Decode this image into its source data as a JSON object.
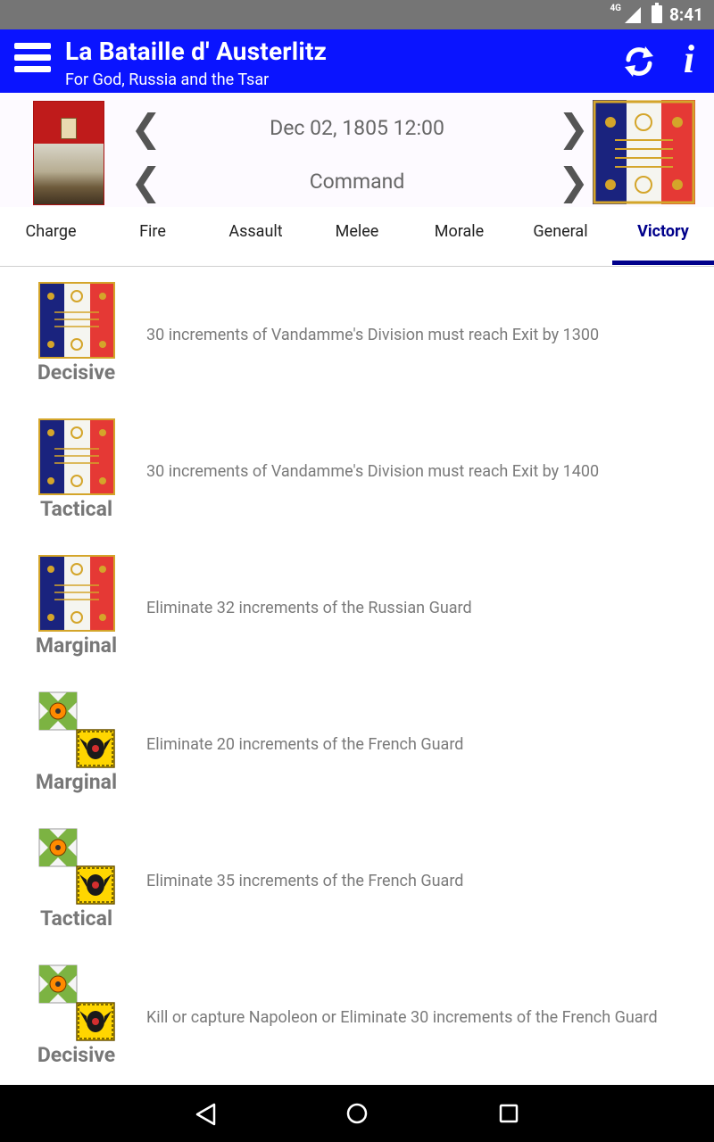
{
  "status_bar": {
    "network": "4G",
    "time": "8:41"
  },
  "app_bar": {
    "title": "La Bataille d' Austerlitz",
    "subtitle": "For God, Russia and the Tsar"
  },
  "header": {
    "date_time": "Dec 02, 1805 12:00",
    "phase": "Command",
    "prev_glyph": "❮",
    "next_glyph": "❯"
  },
  "tabs": [
    {
      "label": "Charge"
    },
    {
      "label": "Fire"
    },
    {
      "label": "Assault"
    },
    {
      "label": "Melee"
    },
    {
      "label": "Morale"
    },
    {
      "label": "General"
    },
    {
      "label": "Victory"
    }
  ],
  "active_tab": "Victory",
  "victory_conditions": [
    {
      "side": "french",
      "level": "Decisive",
      "text": "30 increments of Vandamme's Division must reach Exit by 1300"
    },
    {
      "side": "french",
      "level": "Tactical",
      "text": "30 increments of Vandamme's Division must reach Exit by 1400"
    },
    {
      "side": "french",
      "level": "Marginal",
      "text": "Eliminate 32 increments of the Russian Guard"
    },
    {
      "side": "allied",
      "level": "Marginal",
      "text": "Eliminate 20 increments of the French Guard"
    },
    {
      "side": "allied",
      "level": "Tactical",
      "text": "Eliminate 35 increments of the French Guard"
    },
    {
      "side": "allied",
      "level": "Decisive",
      "text": "Kill or capture Napoleon or Eliminate 30 increments of the French Guard"
    }
  ],
  "colors": {
    "app_bar": "#0a14ff",
    "active_tab": "#00008b",
    "french_blue": "#1a237e",
    "french_red": "#e53935",
    "russian_green": "#8bc34a",
    "austrian_yellow": "#ffd600"
  },
  "icons": {
    "menu": "menu-icon",
    "refresh": "refresh-icon",
    "info": "info-icon",
    "french_flag": "french-eagle-flag-icon",
    "russian_flag": "russian-cross-flag-icon",
    "austrian_flag": "austrian-eagle-flag-icon"
  }
}
